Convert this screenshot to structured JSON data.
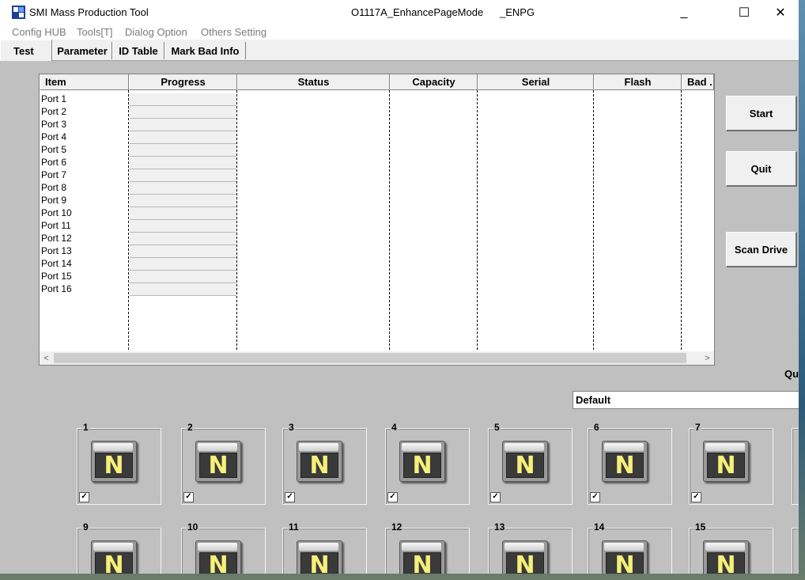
{
  "window": {
    "title": "SMI Mass Production Tool",
    "mode": "O1117A_EnhancePageMode",
    "suffix": "_ENPG",
    "minimize": "_",
    "maximize": "☐",
    "close": "✕"
  },
  "menu": [
    "Config HUB",
    "Tools[T]",
    "Dialog Option",
    "Others Setting"
  ],
  "tabs": [
    "Test",
    "Parameter",
    "ID Table",
    "Mark Bad Info"
  ],
  "list": {
    "columns": [
      "Item",
      "Progress",
      "Status",
      "Capacity",
      "Serial",
      "Flash",
      "Bad ."
    ],
    "rows": [
      "Port 1",
      "Port 2",
      "Port 3",
      "Port 4",
      "Port 5",
      "Port 6",
      "Port 7",
      "Port 8",
      "Port 9",
      "Port 10",
      "Port 11",
      "Port 12",
      "Port 13",
      "Port 14",
      "Port 15",
      "Port 16"
    ],
    "scroll_left": "<",
    "scroll_right": ">"
  },
  "buttons": {
    "start": "Start",
    "quit": "Quit",
    "scan": "Scan Drive"
  },
  "qu_label": "Qu",
  "config_select": "Default",
  "ports": {
    "row1": [
      "1",
      "2",
      "3",
      "4",
      "5",
      "6",
      "7"
    ],
    "row2": [
      "9",
      "10",
      "11",
      "12",
      "13",
      "14",
      "15"
    ],
    "drive_letter": "N",
    "check": "✓"
  },
  "colors": {
    "window_bg": "#c0c0c0",
    "drive_letter": "#f6f07a"
  }
}
